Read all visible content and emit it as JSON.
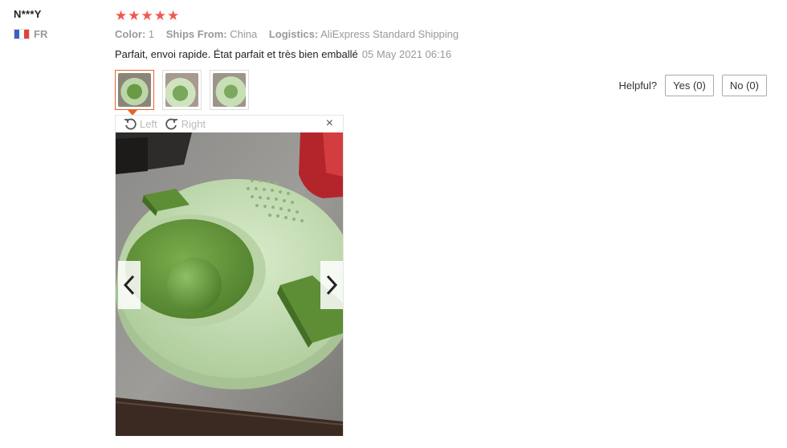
{
  "user": {
    "name": "N***Y",
    "country": "FR"
  },
  "rating": {
    "stars": 5,
    "max": 5
  },
  "meta": [
    {
      "key": "Color:",
      "value": "1"
    },
    {
      "key": "Ships From:",
      "value": "China"
    },
    {
      "key": "Logistics:",
      "value": "AliExpress Standard Shipping"
    }
  ],
  "review": {
    "text": "Parfait, envoi rapide. État parfait et très bien emballé",
    "date": "05 May 2021 06:16"
  },
  "helpful": {
    "label": "Helpful?",
    "yes": "Yes (0)",
    "no": "No (0)"
  },
  "viewer": {
    "rotate_left": "Left",
    "rotate_right": "Right",
    "close": "×"
  },
  "colors": {
    "star": "#f2574f",
    "accent": "#e8622a",
    "muted": "#999999"
  },
  "icons": {
    "prev": "chevron-left-icon",
    "next": "chevron-right-icon",
    "rotate_left": "rotate-ccw-icon",
    "rotate_right": "rotate-cw-icon"
  }
}
